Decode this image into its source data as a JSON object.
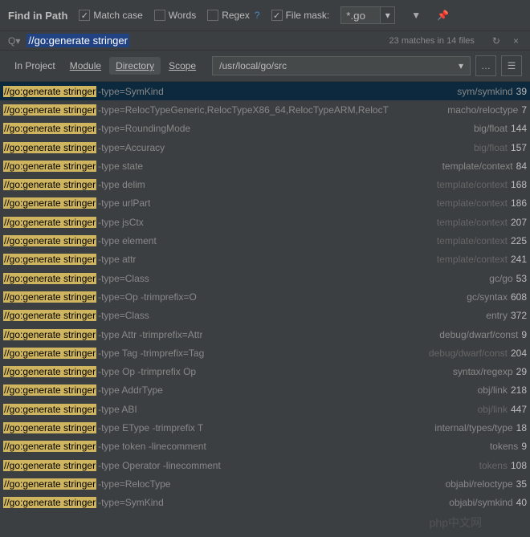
{
  "header": {
    "title": "Find in Path",
    "match_case": "Match case",
    "words": "Words",
    "regex": "Regex",
    "file_mask": "File mask:",
    "file_mask_value": "*.go"
  },
  "search": {
    "query": "//go:generate stringer",
    "match_count": "23 matches in 14 files"
  },
  "scope": {
    "in_project": "In Project",
    "module": "Module",
    "directory": "Directory",
    "scope": "Scope",
    "path": "/usr/local/go/src"
  },
  "results": [
    {
      "highlight": "//go:generate stringer",
      "code": " -type=SymKind",
      "path": "sym/symkind",
      "num": "39",
      "selected": true
    },
    {
      "highlight": "//go:generate stringer",
      "code": " -type=RelocTypeGeneric,RelocTypeX86_64,RelocTypeARM,RelocT",
      "path": "macho/reloctype",
      "num": "7"
    },
    {
      "highlight": "//go:generate stringer",
      "code": " -type=RoundingMode",
      "path": "big/float",
      "num": "144"
    },
    {
      "highlight": "//go:generate stringer",
      "code": " -type=Accuracy",
      "path": "big/float",
      "num": "157",
      "dim": true
    },
    {
      "highlight": "//go:generate stringer",
      "code": " -type state",
      "path": "template/context",
      "num": "84"
    },
    {
      "highlight": "//go:generate stringer",
      "code": " -type delim",
      "path": "template/context",
      "num": "168",
      "dim": true
    },
    {
      "highlight": "//go:generate stringer",
      "code": " -type urlPart",
      "path": "template/context",
      "num": "186",
      "dim": true
    },
    {
      "highlight": "//go:generate stringer",
      "code": " -type jsCtx",
      "path": "template/context",
      "num": "207",
      "dim": true
    },
    {
      "highlight": "//go:generate stringer",
      "code": " -type element",
      "path": "template/context",
      "num": "225",
      "dim": true
    },
    {
      "highlight": "//go:generate stringer",
      "code": " -type attr",
      "path": "template/context",
      "num": "241",
      "dim": true
    },
    {
      "highlight": "//go:generate stringer",
      "code": " -type=Class",
      "path": "gc/go",
      "num": "53"
    },
    {
      "highlight": "//go:generate stringer",
      "code": " -type=Op -trimprefix=O",
      "path": "gc/syntax",
      "num": "608"
    },
    {
      "highlight": "//go:generate stringer",
      "code": " -type=Class",
      "path": "entry",
      "num": "372"
    },
    {
      "highlight": "//go:generate stringer",
      "code": " -type Attr -trimprefix=Attr",
      "path": "debug/dwarf/const",
      "num": "9"
    },
    {
      "highlight": "//go:generate stringer",
      "code": " -type Tag -trimprefix=Tag",
      "path": "debug/dwarf/const",
      "num": "204",
      "dim": true
    },
    {
      "highlight": "//go:generate stringer",
      "code": " -type Op -trimprefix Op",
      "path": "syntax/regexp",
      "num": "29"
    },
    {
      "highlight": "//go:generate stringer",
      "code": " -type AddrType",
      "path": "obj/link",
      "num": "218"
    },
    {
      "highlight": "//go:generate stringer",
      "code": " -type ABI",
      "path": "obj/link",
      "num": "447",
      "dim": true
    },
    {
      "highlight": "//go:generate stringer",
      "code": " -type EType -trimprefix T",
      "path": "internal/types/type",
      "num": "18"
    },
    {
      "highlight": "//go:generate stringer",
      "code": " -type token -linecomment",
      "path": "tokens",
      "num": "9"
    },
    {
      "highlight": "//go:generate stringer",
      "code": " -type Operator -linecomment",
      "path": "tokens",
      "num": "108",
      "dim": true
    },
    {
      "highlight": "//go:generate stringer",
      "code": " -type=RelocType",
      "path": "objabi/reloctype",
      "num": "35"
    },
    {
      "highlight": "//go:generate stringer",
      "code": " -type=SymKind",
      "path": "objabi/symkind",
      "num": "40"
    }
  ],
  "watermark": "php中文网"
}
